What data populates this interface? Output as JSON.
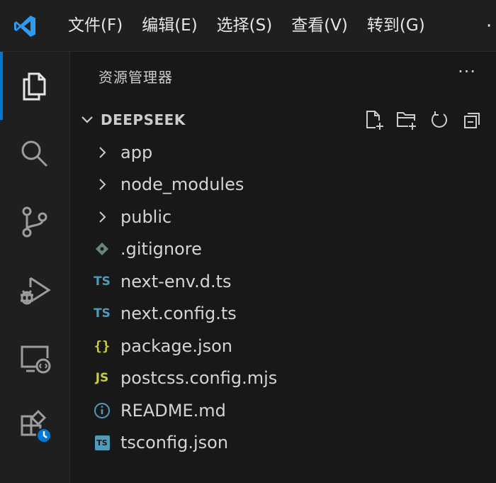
{
  "colors": {
    "accent": "#0078d4",
    "ts": "#519aba",
    "js": "#cbcb41",
    "json": "#cbcb41",
    "info": "#519aba",
    "git": "#6d8086"
  },
  "menu": {
    "items": [
      {
        "label": "文件(F)"
      },
      {
        "label": "编辑(E)"
      },
      {
        "label": "选择(S)"
      },
      {
        "label": "查看(V)"
      },
      {
        "label": "转到(G)"
      }
    ],
    "more_label": "·"
  },
  "activity_bar": {
    "items": [
      {
        "icon": "explorer-icon",
        "active": true
      },
      {
        "icon": "search-icon"
      },
      {
        "icon": "source-control-icon"
      },
      {
        "icon": "run-debug-icon"
      },
      {
        "icon": "remote-explorer-icon"
      },
      {
        "icon": "extensions-icon"
      }
    ]
  },
  "explorer": {
    "title": "资源管理器",
    "more_label": "···",
    "section_title": "DEEPSEEK",
    "tree": [
      {
        "name": "app",
        "type": "folder"
      },
      {
        "name": "node_modules",
        "type": "folder"
      },
      {
        "name": "public",
        "type": "folder"
      },
      {
        "name": ".gitignore",
        "type": "file",
        "icon": "git-icon"
      },
      {
        "name": "next-env.d.ts",
        "type": "file",
        "icon": "typescript-icon",
        "badge": "TS"
      },
      {
        "name": "next.config.ts",
        "type": "file",
        "icon": "typescript-icon",
        "badge": "TS"
      },
      {
        "name": "package.json",
        "type": "file",
        "icon": "json-icon",
        "badge": "{}"
      },
      {
        "name": "postcss.config.mjs",
        "type": "file",
        "icon": "javascript-icon",
        "badge": "JS"
      },
      {
        "name": "README.md",
        "type": "file",
        "icon": "info-icon"
      },
      {
        "name": "tsconfig.json",
        "type": "file",
        "icon": "tsconfig-icon",
        "badge": "TS"
      }
    ]
  }
}
